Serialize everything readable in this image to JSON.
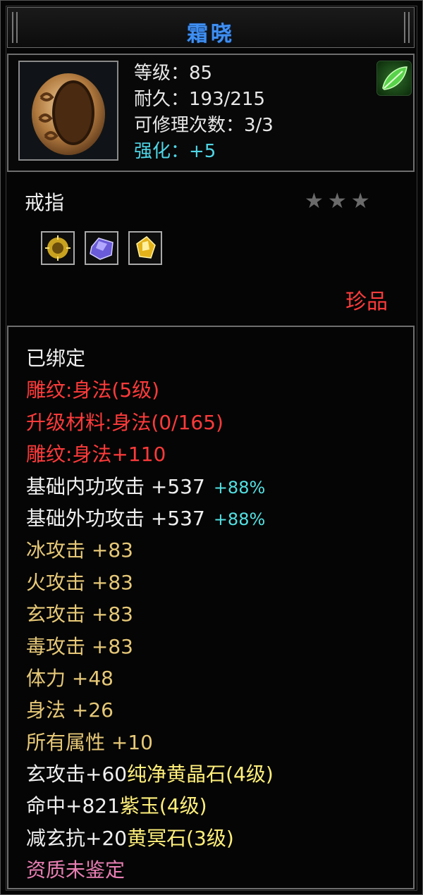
{
  "item": {
    "name": "霜晓",
    "stats": {
      "level": "等级：85",
      "durability": "耐久：193/215",
      "repair": "可修理次数：3/3",
      "enhance": "强化：+5"
    },
    "type": "戒指",
    "stars_text": "★★★",
    "rarity": "珍品",
    "gems": [
      "yellow-sun-gem",
      "purple-crystal-gem",
      "yellow-crystal-gem"
    ],
    "icons": {
      "item": "ring-icon",
      "set": "green-leaf-icon"
    },
    "colors": {
      "title": "#3f8ff2",
      "red": "#ff3a3a",
      "gold": "#e6c877",
      "cyan": "#52e0e2",
      "pink": "#e97fb3"
    }
  },
  "attributes": {
    "bound": "已绑定",
    "engrave": "雕纹:身法(5级)",
    "upgrade": "升级材料:身法(0/165)",
    "engrave_bonus": "雕纹:身法+110",
    "inner_attack": "基础内功攻击 +537",
    "inner_attack_pct": "+88%",
    "outer_attack": "基础外功攻击 +537",
    "outer_attack_pct": "+88%",
    "ice": "冰攻击 +83",
    "fire": "火攻击 +83",
    "xuan": "玄攻击 +83",
    "poison": "毒攻击 +83",
    "stamina": "体力 +48",
    "agility": "身法 +26",
    "all": "所有属性 +10",
    "gem1_prefix": "玄攻击+60",
    "gem1_name": "纯净黄晶石(4级)",
    "gem2_prefix": "命中+821",
    "gem2_name": "紫玉(4级)",
    "gem3_prefix": "减玄抗+20",
    "gem3_name": "黄冥石(3级)",
    "quality": "资质未鉴定"
  }
}
